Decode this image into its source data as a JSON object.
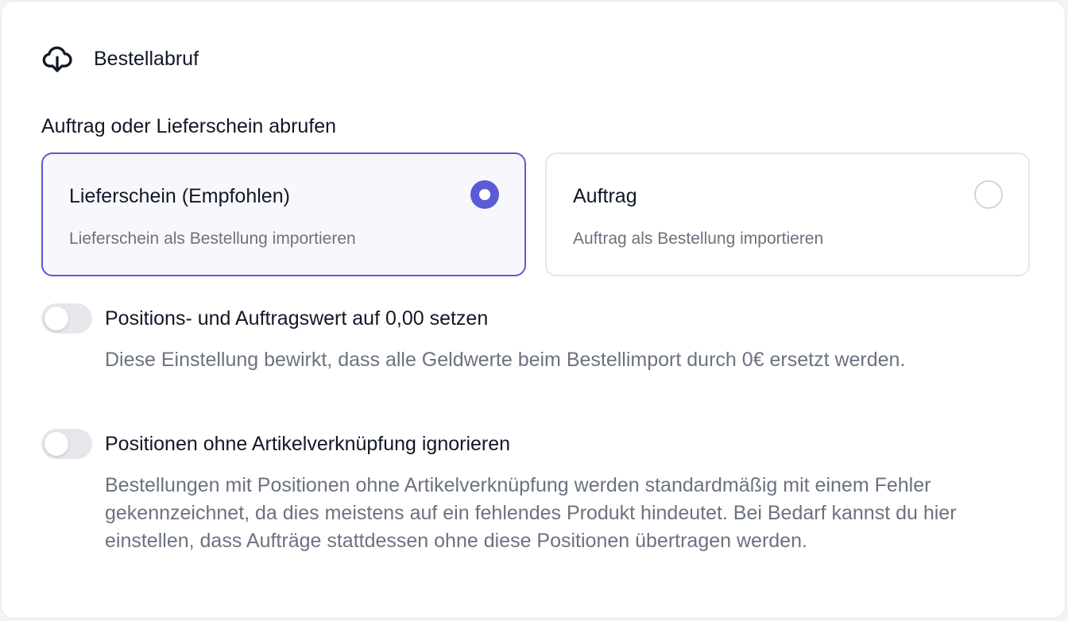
{
  "header": {
    "icon": "cloud-download-icon",
    "title": "Bestellabruf"
  },
  "fetch_type": {
    "label": "Auftrag oder Lieferschein abrufen",
    "options": [
      {
        "title": "Lieferschein (Empfohlen)",
        "description": "Lieferschein als Bestellung importieren",
        "selected": true
      },
      {
        "title": "Auftrag",
        "description": "Auftrag als Bestellung importieren",
        "selected": false
      }
    ]
  },
  "settings": [
    {
      "title": "Positions- und Auftragswert auf 0,00 setzen",
      "description": "Diese Einstellung bewirkt, dass alle Geldwerte beim Bestellimport durch 0€ ersetzt werden.",
      "enabled": false
    },
    {
      "title": "Positionen ohne Artikelverknüpfung ignorieren",
      "description": "Bestellungen mit Positionen ohne Artikelverknüpfung werden standardmäßig mit einem Fehler gekennzeichnet, da dies meistens auf ein fehlendes Produkt hindeutet. Bei Bedarf kannst du hier einstellen, dass Aufträge stattdessen ohne diese Positionen übertragen werden.",
      "enabled": false
    }
  ],
  "colors": {
    "accent": "#5b5bd6",
    "text_primary": "#111827",
    "text_secondary": "#6b7280",
    "toggle_off": "#e5e7eb"
  }
}
